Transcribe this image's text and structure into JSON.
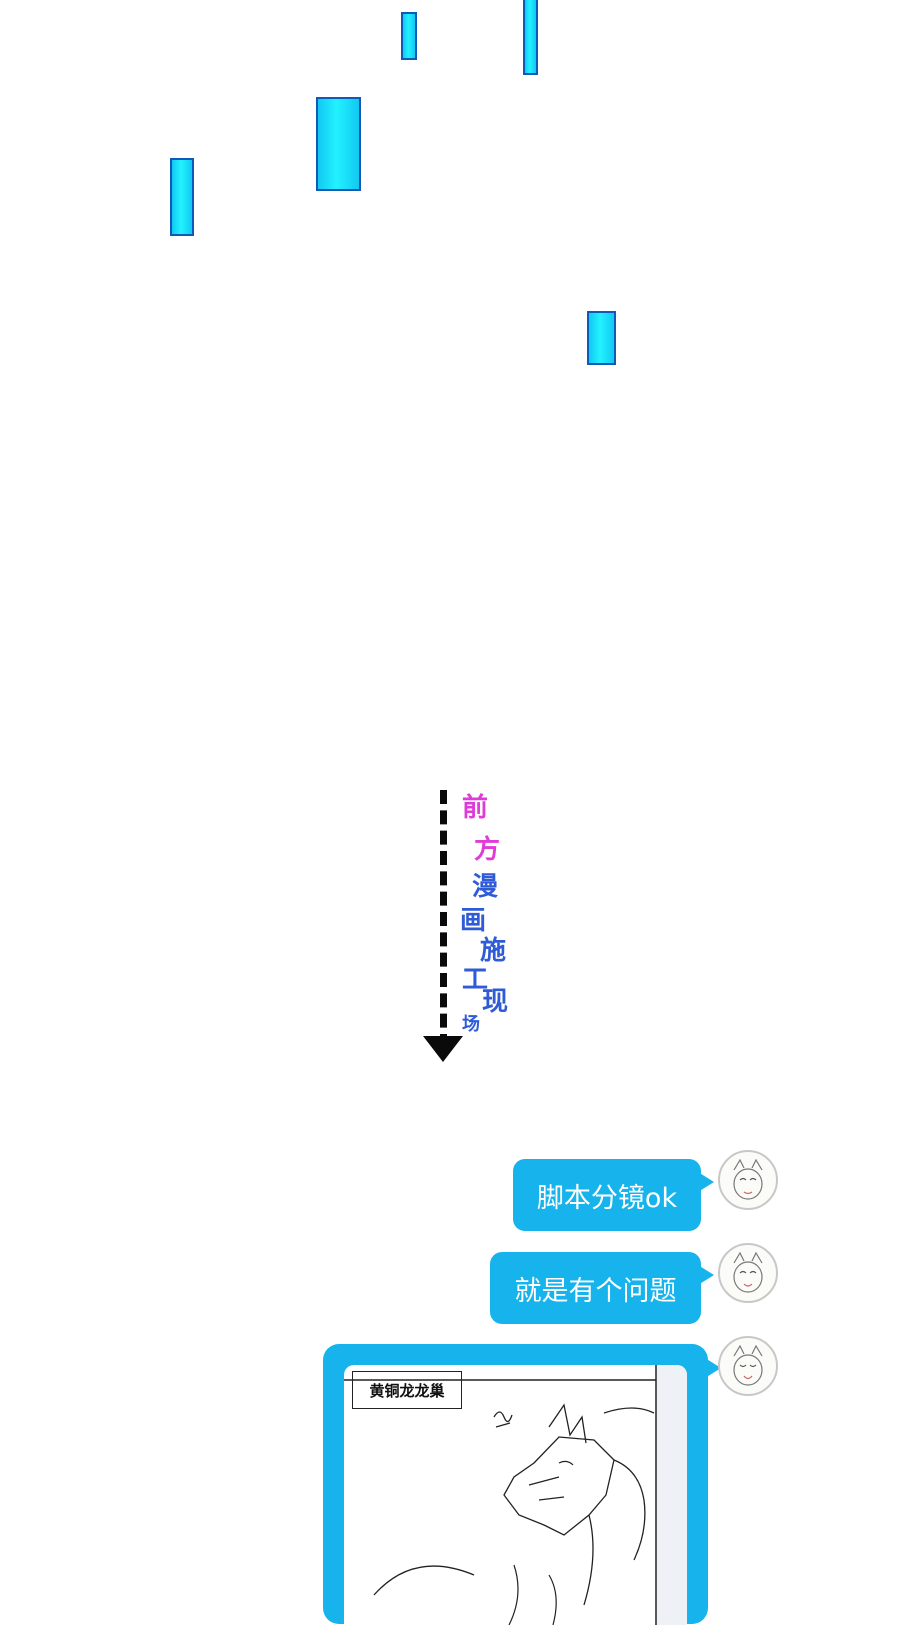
{
  "vertical_text": {
    "chars": [
      "前",
      "方",
      "漫",
      "画",
      "施",
      "工",
      "现",
      "场"
    ],
    "colors": [
      "#e03ad8",
      "#e03ad8",
      "#2f5bd6",
      "#2f5bd6",
      "#2f5bd6",
      "#2f5bd6",
      "#2f5bd6",
      "#2f5bd6"
    ]
  },
  "chat": {
    "bubble_color": "#17b3ec",
    "messages": [
      {
        "text": "脚本分镜ok"
      },
      {
        "text": "就是有个问题"
      }
    ],
    "image_message": {
      "label": "黄铜龙龙巢"
    }
  }
}
